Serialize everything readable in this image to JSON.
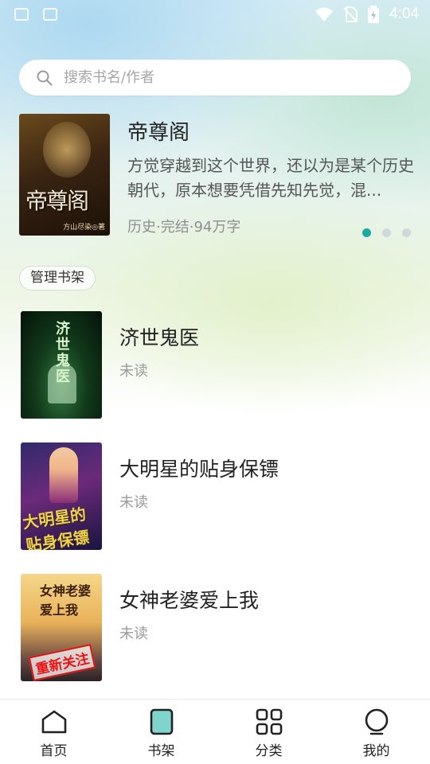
{
  "status_bar": {
    "time": "4:04"
  },
  "search": {
    "placeholder": "搜索书名/作者"
  },
  "featured": {
    "title": "帝尊阁",
    "description": "方觉穿越到这个世界，还以为是某个历史朝代，原本想要凭借先知先觉，混...",
    "meta": "历史·完结·94万字",
    "cover_text": "帝尊阁",
    "cover_author": "方山尽染◎著",
    "carousel": {
      "count": 3,
      "active_index": 0
    }
  },
  "shelf": {
    "manage_label": "管理书架",
    "books": [
      {
        "title": "济世鬼医",
        "status": "未读",
        "cover_text": "济世鬼医"
      },
      {
        "title": "大明星的贴身保镖",
        "status": "未读",
        "cover_text": "大明星的贴身保镖"
      },
      {
        "title": "女神老婆爱上我",
        "status": "未读",
        "cover_text": "女神老婆爱上我",
        "cover_stamp": "重新关注"
      }
    ]
  },
  "bottom_nav": {
    "items": [
      {
        "label": "首页",
        "icon": "home-icon"
      },
      {
        "label": "书架",
        "icon": "bookshelf-icon",
        "active": true
      },
      {
        "label": "分类",
        "icon": "grid-icon"
      },
      {
        "label": "我的",
        "icon": "profile-icon"
      }
    ]
  },
  "colors": {
    "accent": "#1aaaa0",
    "accent_fill": "#7fd4cc",
    "text_primary": "#222222",
    "text_secondary": "#8f8f8f"
  }
}
